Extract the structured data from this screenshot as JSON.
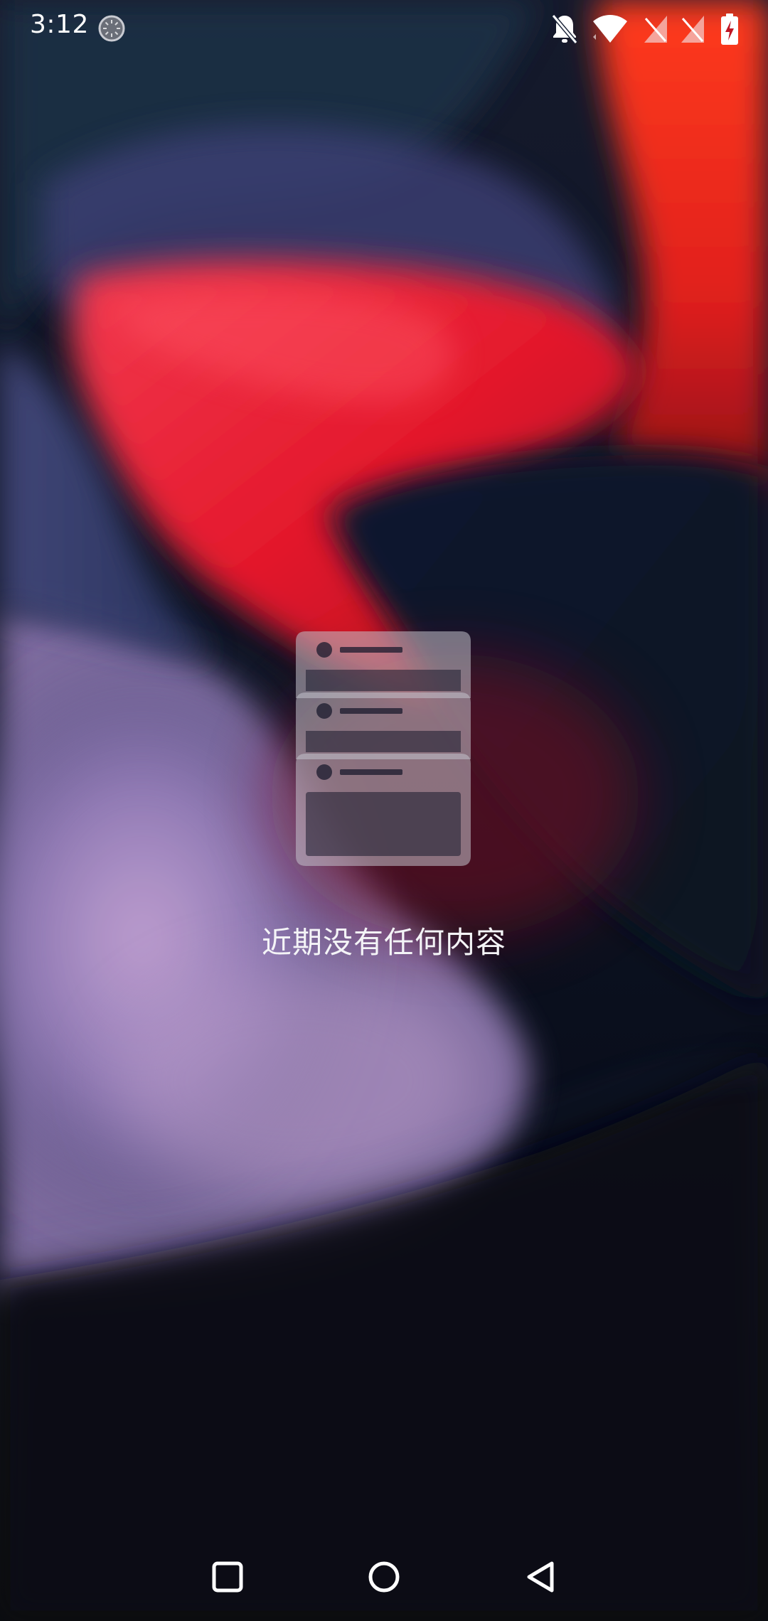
{
  "status_bar": {
    "time": "3:12",
    "icons": [
      "loading-icon",
      "bell-off-icon",
      "wifi-icon",
      "sim-1-no-signal-icon",
      "sim-2-no-signal-icon",
      "battery-charging-icon"
    ]
  },
  "recents": {
    "empty_icon": "stacked-windows-icon",
    "empty_message": "近期没有任何内容"
  },
  "nav_bar": {
    "buttons": [
      "recents-square-icon",
      "home-circle-icon",
      "back-triangle-icon"
    ]
  },
  "colors": {
    "text": "#ffffff",
    "icon_overlay": "#b9b9c4",
    "accent_red": "#e8202f"
  }
}
